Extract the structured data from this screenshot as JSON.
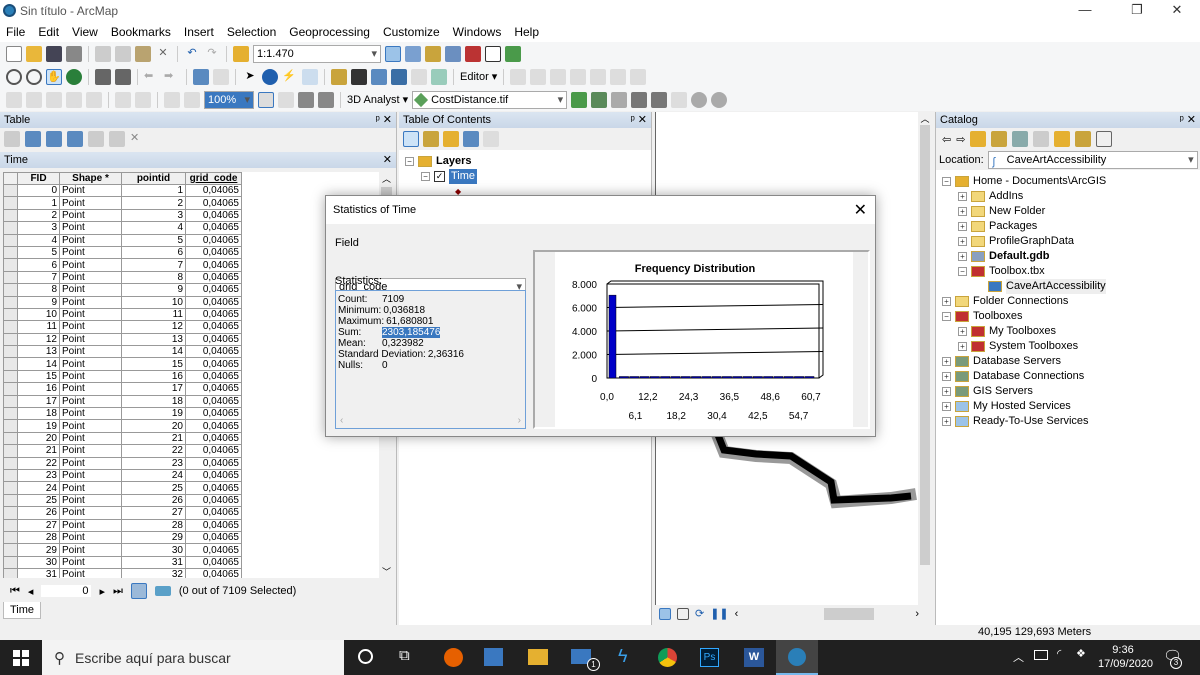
{
  "window": {
    "title": "Sin título - ArcMap"
  },
  "menu": [
    "File",
    "Edit",
    "View",
    "Bookmarks",
    "Insert",
    "Selection",
    "Geoprocessing",
    "Customize",
    "Windows",
    "Help"
  ],
  "toolbar": {
    "scale": "1:1.470",
    "editor": "Editor",
    "analyst": "3D Analyst",
    "layer_combo": "CostDistance.tif",
    "zoom_combo": "100%"
  },
  "table_panel": {
    "title": "Table",
    "table_name": "Time",
    "columns": [
      "FID",
      "Shape *",
      "pointid",
      "grid_code"
    ],
    "rows": [
      [
        0,
        "Point",
        1,
        "0,04065"
      ],
      [
        1,
        "Point",
        2,
        "0,04065"
      ],
      [
        2,
        "Point",
        3,
        "0,04065"
      ],
      [
        3,
        "Point",
        4,
        "0,04065"
      ],
      [
        4,
        "Point",
        5,
        "0,04065"
      ],
      [
        5,
        "Point",
        6,
        "0,04065"
      ],
      [
        6,
        "Point",
        7,
        "0,04065"
      ],
      [
        7,
        "Point",
        8,
        "0,04065"
      ],
      [
        8,
        "Point",
        9,
        "0,04065"
      ],
      [
        9,
        "Point",
        10,
        "0,04065"
      ],
      [
        10,
        "Point",
        11,
        "0,04065"
      ],
      [
        11,
        "Point",
        12,
        "0,04065"
      ],
      [
        12,
        "Point",
        13,
        "0,04065"
      ],
      [
        13,
        "Point",
        14,
        "0,04065"
      ],
      [
        14,
        "Point",
        15,
        "0,04065"
      ],
      [
        15,
        "Point",
        16,
        "0,04065"
      ],
      [
        16,
        "Point",
        17,
        "0,04065"
      ],
      [
        17,
        "Point",
        18,
        "0,04065"
      ],
      [
        18,
        "Point",
        19,
        "0,04065"
      ],
      [
        19,
        "Point",
        20,
        "0,04065"
      ],
      [
        20,
        "Point",
        21,
        "0,04065"
      ],
      [
        21,
        "Point",
        22,
        "0,04065"
      ],
      [
        22,
        "Point",
        23,
        "0,04065"
      ],
      [
        23,
        "Point",
        24,
        "0,04065"
      ],
      [
        24,
        "Point",
        25,
        "0,04065"
      ],
      [
        25,
        "Point",
        26,
        "0,04065"
      ],
      [
        26,
        "Point",
        27,
        "0,04065"
      ],
      [
        27,
        "Point",
        28,
        "0,04065"
      ],
      [
        28,
        "Point",
        29,
        "0,04065"
      ],
      [
        29,
        "Point",
        30,
        "0,04065"
      ],
      [
        30,
        "Point",
        31,
        "0,04065"
      ],
      [
        31,
        "Point",
        32,
        "0,04065"
      ]
    ],
    "record": "0",
    "selection_status": "(0 out of 7109 Selected)",
    "tab": "Time"
  },
  "toc": {
    "title": "Table Of Contents",
    "layers_label": "Layers",
    "layer": "Time"
  },
  "dialog": {
    "title": "Statistics of Time",
    "field_label": "Field",
    "field_value": "grid_code",
    "stats_label": "Statistics:",
    "stats": [
      {
        "k": "Count:",
        "v": "7109"
      },
      {
        "k": "Minimum:",
        "v": "0,036818"
      },
      {
        "k": "Maximum:",
        "v": "61,680801"
      },
      {
        "k": "Sum:",
        "v": "2303,185476"
      },
      {
        "k": "Mean:",
        "v": "0,323982"
      },
      {
        "k": "Standard Deviation:",
        "v": "2,36316"
      },
      {
        "k": "Nulls:",
        "v": "0"
      }
    ]
  },
  "chart_data": {
    "type": "bar",
    "title": "Frequency Distribution",
    "ylim": [
      0,
      8000
    ],
    "yticks": [
      "8.000",
      "6.000",
      "4.000",
      "2.000",
      "0"
    ],
    "xticks_top": [
      "0,0",
      "12,2",
      "24,3",
      "36,5",
      "48,6",
      "60,7"
    ],
    "xticks_bottom": [
      "6,1",
      "18,2",
      "30,4",
      "42,5",
      "54,7"
    ],
    "values": [
      7050,
      12,
      8,
      6,
      5,
      4,
      4,
      3,
      3,
      2,
      2,
      2,
      2,
      1,
      1,
      1,
      1,
      1,
      1,
      0
    ],
    "bar_color": "#0000c8",
    "grid": true
  },
  "catalog": {
    "title": "Catalog",
    "location_label": "Location:",
    "location": "CaveArtAccessibility",
    "items": [
      {
        "label": "Home - Documents\\ArcGIS",
        "level": 0,
        "pm": "−",
        "icon": "home-folder"
      },
      {
        "label": "AddIns",
        "level": 1,
        "pm": "+",
        "icon": "folder"
      },
      {
        "label": "New Folder",
        "level": 1,
        "pm": "+",
        "icon": "folder"
      },
      {
        "label": "Packages",
        "level": 1,
        "pm": "+",
        "icon": "folder"
      },
      {
        "label": "ProfileGraphData",
        "level": 1,
        "pm": "+",
        "icon": "folder"
      },
      {
        "label": "Default.gdb",
        "level": 1,
        "pm": "+",
        "icon": "geodatabase",
        "bold": true
      },
      {
        "label": "Toolbox.tbx",
        "level": 1,
        "pm": "−",
        "icon": "toolbox"
      },
      {
        "label": "CaveArtAccessibility",
        "level": 2,
        "pm": "",
        "icon": "model"
      },
      {
        "label": "Folder Connections",
        "level": 0,
        "pm": "+",
        "icon": "folder"
      },
      {
        "label": "Toolboxes",
        "level": 0,
        "pm": "−",
        "icon": "toolbox"
      },
      {
        "label": "My Toolboxes",
        "level": 1,
        "pm": "+",
        "icon": "toolbox"
      },
      {
        "label": "System Toolboxes",
        "level": 1,
        "pm": "+",
        "icon": "toolbox"
      },
      {
        "label": "Database Servers",
        "level": 0,
        "pm": "+",
        "icon": "server"
      },
      {
        "label": "Database Connections",
        "level": 0,
        "pm": "+",
        "icon": "server"
      },
      {
        "label": "GIS Servers",
        "level": 0,
        "pm": "+",
        "icon": "server"
      },
      {
        "label": "My Hosted Services",
        "level": 0,
        "pm": "+",
        "icon": "cloud"
      },
      {
        "label": "Ready-To-Use Services",
        "level": 0,
        "pm": "+",
        "icon": "cloud"
      }
    ]
  },
  "status": {
    "coords": "40,195  129,693 Meters"
  },
  "taskbar": {
    "search_placeholder": "Escribe aquí para buscar",
    "time": "9:36",
    "date": "17/09/2020",
    "notifications": "3",
    "mail_badge": "1"
  }
}
